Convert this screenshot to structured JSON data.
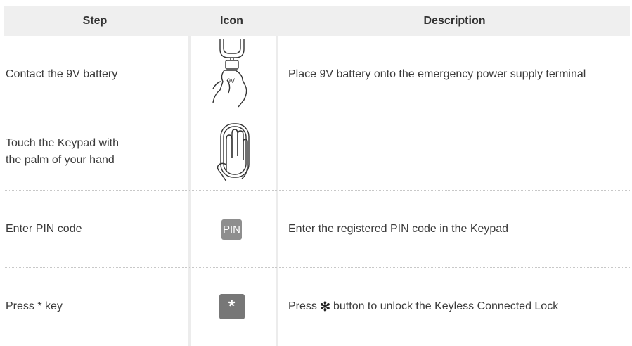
{
  "header": {
    "step": "Step",
    "icon": "Icon",
    "description": "Description"
  },
  "rows": [
    {
      "step": "Contact the 9V battery",
      "icon": "battery-hand-icon",
      "description": "Place 9V battery onto the emergency power supply terminal",
      "icon_label": "9V"
    },
    {
      "step": "Touch the Keypad with\nthe palm of your hand",
      "icon": "palm-keypad-icon",
      "description": ""
    },
    {
      "step": "Enter PIN code",
      "icon": "pin-icon",
      "icon_label": "PIN",
      "description": "Enter the registered PIN code in the Keypad"
    },
    {
      "step": "Press * key",
      "icon": "asterisk-key-icon",
      "icon_label": "*",
      "description_before": "Press",
      "description_symbol": "✻",
      "description_after": "button to unlock the Keyless Connected Lock"
    }
  ],
  "colors": {
    "header_bg": "#efefef",
    "icon_box": "#8e8e8e",
    "star_box": "#777777"
  }
}
